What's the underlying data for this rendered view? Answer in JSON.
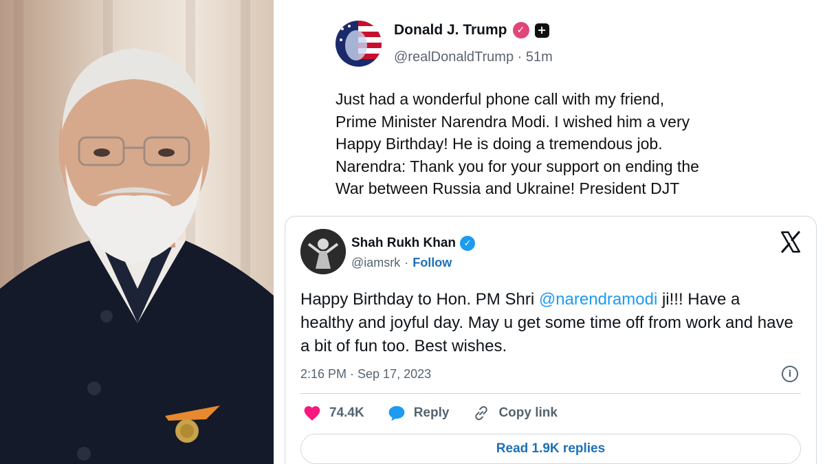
{
  "truth_post": {
    "display_name": "Donald J. Trump",
    "handle": "@realDonaldTrump",
    "separator": "·",
    "time_ago": "51m",
    "text_lines": [
      "Just had a wonderful phone call with my friend,",
      "Prime Minister Narendra Modi. I wished him a very",
      "Happy Birthday! He is doing a tremendous job.",
      "Narendra: Thank you for your support on ending the",
      "War between Russia and Ukraine! President DJT"
    ],
    "verified_color": "#e0457b"
  },
  "x_post": {
    "display_name": "Shah Rukh Khan",
    "handle": "@iamsrk",
    "separator": "·",
    "follow_label": "Follow",
    "text_before_mention": "Happy Birthday to Hon. PM Shri ",
    "mention": "@narendramodi",
    "text_after_mention": " ji!!! Have a healthy and joyful day. May u get some time off from work and have a bit of fun too. Best wishes.",
    "timestamp": "2:16 PM · Sep 17, 2023",
    "like_count": "74.4K",
    "reply_label": "Reply",
    "copy_link_label": "Copy link",
    "read_replies_label": "Read 1.9K replies",
    "verified_color": "#1d9bf0",
    "link_color": "#1d70b8",
    "like_color": "#f91880"
  },
  "icons": [
    "verified-badge-icon",
    "plus-badge-icon",
    "x-logo-icon",
    "info-icon",
    "heart-icon",
    "reply-bubble-icon",
    "link-icon"
  ]
}
